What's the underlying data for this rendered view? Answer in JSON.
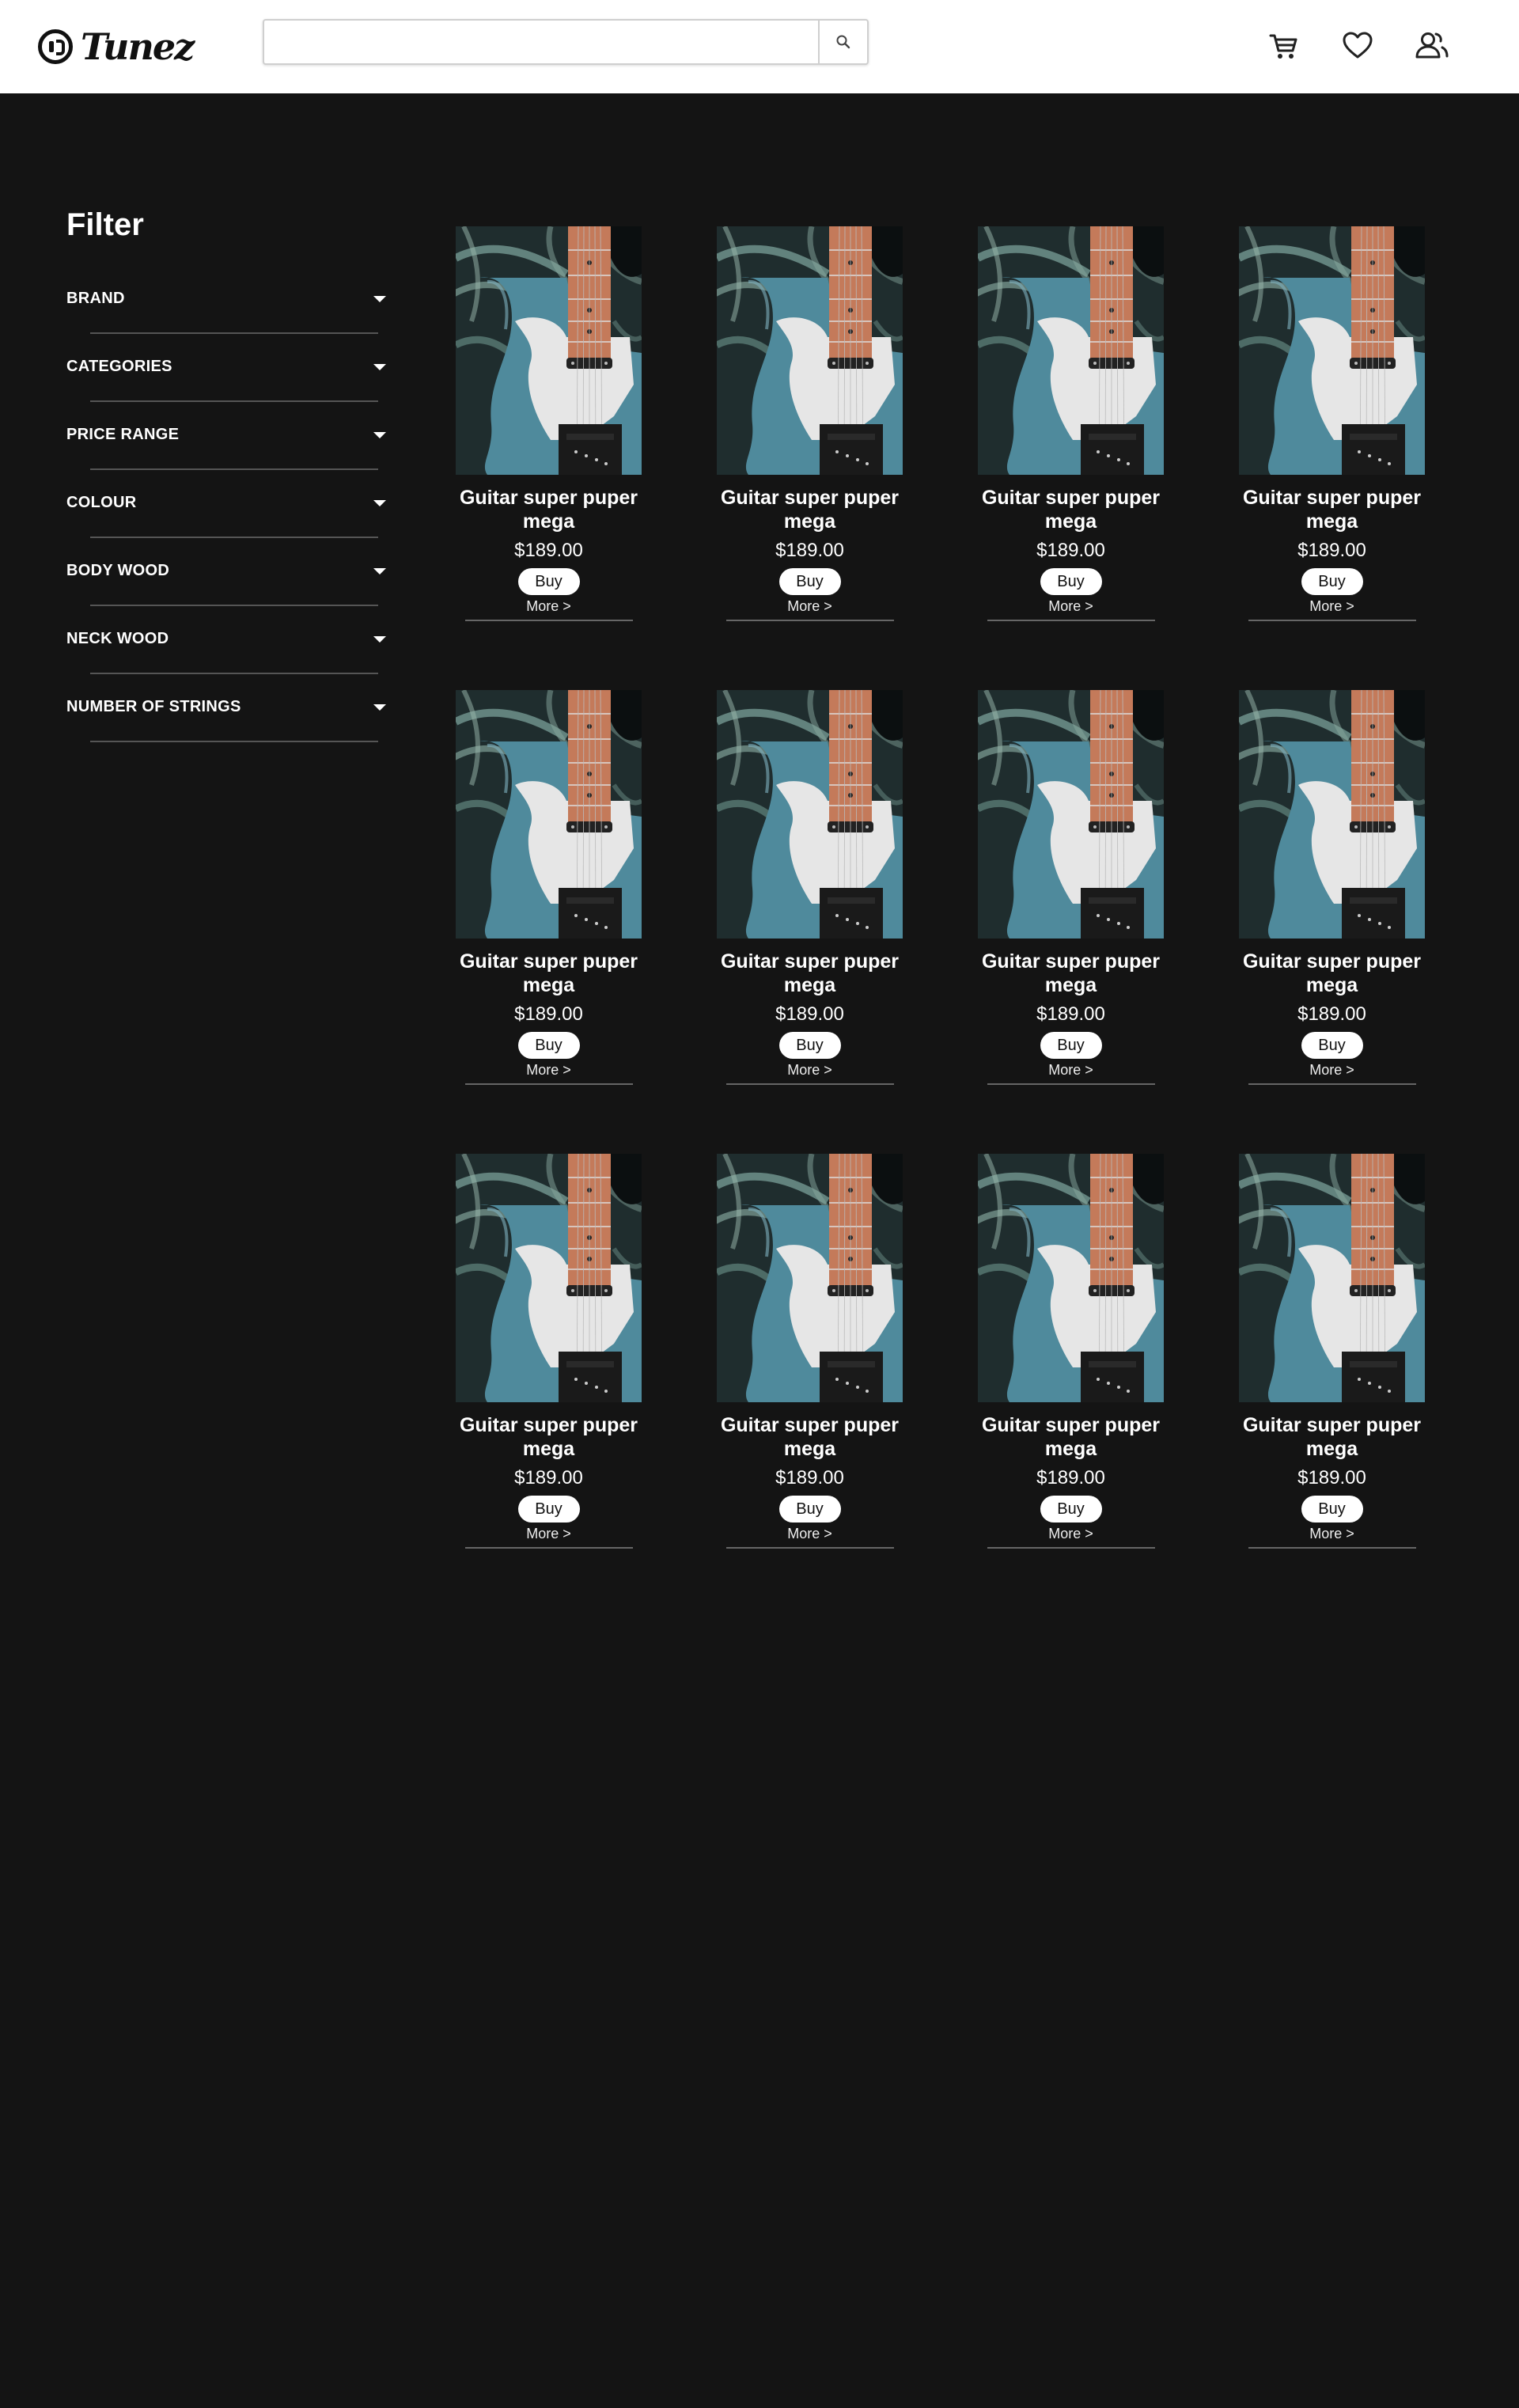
{
  "header": {
    "logo_text": "Tunez",
    "search": {
      "value": "",
      "placeholder": ""
    },
    "icons": [
      "cart-icon",
      "heart-icon",
      "user-icon"
    ]
  },
  "sidebar": {
    "title": "Filter",
    "filters": [
      {
        "label": "BRAND"
      },
      {
        "label": "CATEGORIES"
      },
      {
        "label": "PRICE RANGE"
      },
      {
        "label": "COLOUR"
      },
      {
        "label": "BODY WOOD"
      },
      {
        "label": "NECK WOOD"
      },
      {
        "label": "NUMBER OF STRINGS"
      }
    ]
  },
  "products": [
    {
      "name": "Guitar super puper mega",
      "price": "$189.00",
      "buy_label": "Buy",
      "more_label": "More >"
    },
    {
      "name": "Guitar super puper mega",
      "price": "$189.00",
      "buy_label": "Buy",
      "more_label": "More >"
    },
    {
      "name": "Guitar super puper mega",
      "price": "$189.00",
      "buy_label": "Buy",
      "more_label": "More >"
    },
    {
      "name": "Guitar super puper mega",
      "price": "$189.00",
      "buy_label": "Buy",
      "more_label": "More >"
    },
    {
      "name": "Guitar super puper mega",
      "price": "$189.00",
      "buy_label": "Buy",
      "more_label": "More >"
    },
    {
      "name": "Guitar super puper mega",
      "price": "$189.00",
      "buy_label": "Buy",
      "more_label": "More >"
    },
    {
      "name": "Guitar super puper mega",
      "price": "$189.00",
      "buy_label": "Buy",
      "more_label": "More >"
    },
    {
      "name": "Guitar super puper mega",
      "price": "$189.00",
      "buy_label": "Buy",
      "more_label": "More >"
    },
    {
      "name": "Guitar super puper mega",
      "price": "$189.00",
      "buy_label": "Buy",
      "more_label": "More >"
    },
    {
      "name": "Guitar super puper mega",
      "price": "$189.00",
      "buy_label": "Buy",
      "more_label": "More >"
    },
    {
      "name": "Guitar super puper mega",
      "price": "$189.00",
      "buy_label": "Buy",
      "more_label": "More >"
    },
    {
      "name": "Guitar super puper mega",
      "price": "$189.00",
      "buy_label": "Buy",
      "more_label": "More >"
    }
  ],
  "colors": {
    "background": "#141414",
    "header": "#ffffff",
    "guitar_body": "#4f8a9c",
    "pickguard": "#e6e6e6",
    "fretboard": "#c47a5a"
  }
}
